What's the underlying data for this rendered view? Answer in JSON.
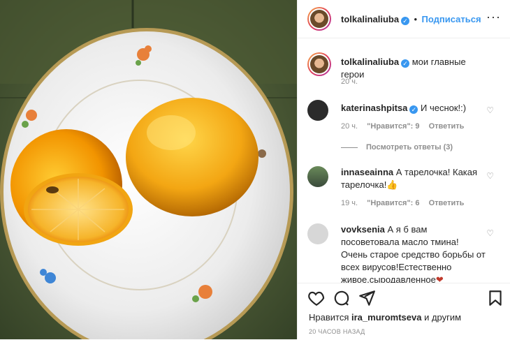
{
  "post": {
    "author": "tolkalinaliuba",
    "follow_label": "Подписаться",
    "more_label": "···",
    "caption": "мои главные герои",
    "caption_time": "20 ч."
  },
  "comments": [
    {
      "user": "katerinashpitsa",
      "text": "И чеснок!:)",
      "time": "20 ч.",
      "likes": "\"Нравится\": 9",
      "reply": "Ответить",
      "verified": true
    },
    {
      "user": "innaseainna",
      "text": "А тарелочка! Какая тарелочка!",
      "time": "19 ч.",
      "likes": "\"Нравится\": 6",
      "reply": "Ответить",
      "verified": false
    },
    {
      "user": "vovksenia",
      "text": "А я б вам посоветовала масло тмина! Очень старое средство борьбы от всех вирусов!Естественно живое,сыродавленное",
      "verified": false
    }
  ],
  "view_replies": "Посмотреть ответы (3)",
  "likes_prefix": "Нравится",
  "likes_user": "ira_muromtseva",
  "likes_suffix": "и другим",
  "post_time": "20 ЧАСОВ НАЗАД",
  "icons": [
    "heart-icon",
    "comment-icon",
    "share-icon",
    "bookmark-icon",
    "more-icon",
    "verified-icon"
  ]
}
